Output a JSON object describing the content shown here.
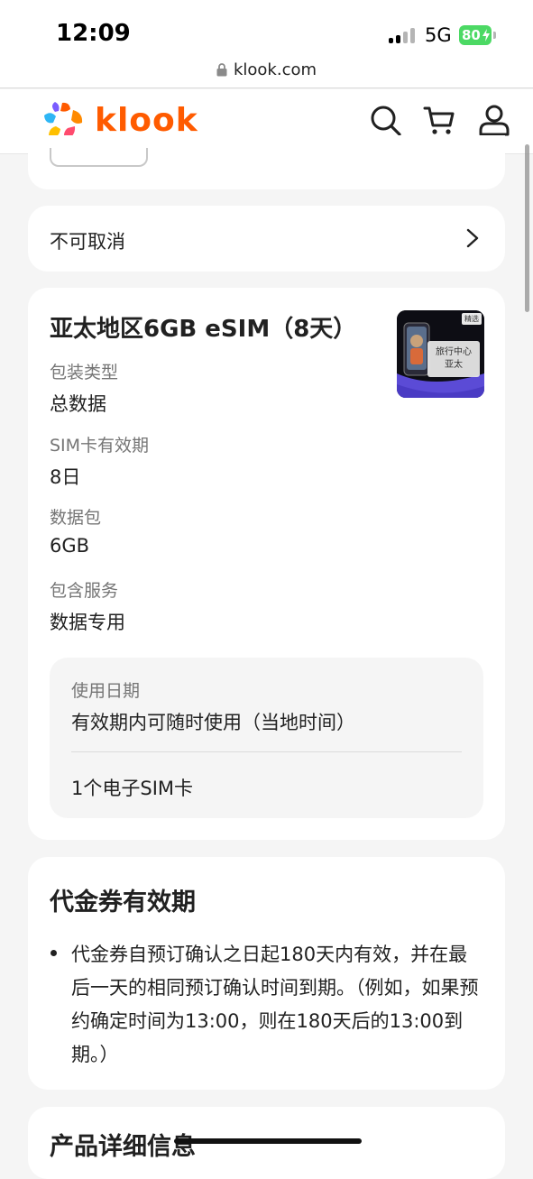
{
  "status_bar": {
    "time": "12:09",
    "network": "5G",
    "battery": "80"
  },
  "browser": {
    "url": "klook.com"
  },
  "header": {
    "logo_text": "klook"
  },
  "cancellation": {
    "label": "不可取消"
  },
  "product": {
    "title": "亚太地区6GB eSIM（8天）",
    "thumbnail": {
      "tag": "精选",
      "line1": "旅行中心",
      "line2": "亚太"
    },
    "fields": [
      {
        "label": "包装类型",
        "value": "总数据"
      },
      {
        "label": "SIM卡有效期",
        "value": "8日"
      },
      {
        "label": "数据包",
        "value": "6GB"
      },
      {
        "label": "包含服务",
        "value": "数据专用"
      }
    ],
    "usage": {
      "label": "使用日期",
      "value": "有效期内可随时使用（当地时间）",
      "sim": "1个电子SIM卡"
    }
  },
  "voucher": {
    "title": "代金券有效期",
    "text": "代金券自预订确认之日起180天内有效，并在最后一天的相同预订确认时间到期。（例如，如果预约确定时间为13:00，则在180天后的13:00到期。）"
  },
  "details": {
    "title": "产品详细信息"
  },
  "colors": {
    "brand": "#ff5b00",
    "battery": "#4cd964",
    "background": "#f5f5f5"
  }
}
